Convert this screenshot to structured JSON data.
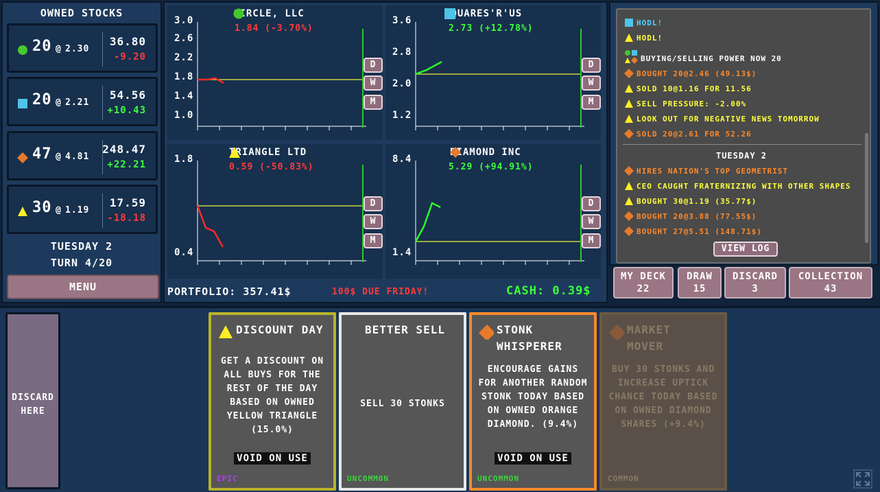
{
  "owned": {
    "title": "OWNED STOCKS",
    "stocks": [
      {
        "icon": "green-circle-icon",
        "qty": "20",
        "at": "@",
        "price": "2.30",
        "value": "36.80",
        "change": "-9.20",
        "change_color": "#ff3b3b"
      },
      {
        "icon": "blue-square-icon",
        "qty": "20",
        "at": "@",
        "price": "2.21",
        "value": "54.56",
        "change": "+10.43",
        "change_color": "#3cff3c"
      },
      {
        "icon": "orange-diamond-icon",
        "qty": "47",
        "at": "@",
        "price": "4.81",
        "value": "248.47",
        "change": "+22.21",
        "change_color": "#3cff3c"
      },
      {
        "icon": "yellow-triangle-icon",
        "qty": "30",
        "at": "@",
        "price": "1.19",
        "value": "17.59",
        "change": "-18.18",
        "change_color": "#ff3b3b"
      }
    ],
    "day": "TUESDAY 2",
    "turn": "TURN 4/20",
    "menu_label": "MENU"
  },
  "charts": [
    {
      "name": "CIRCLE, LLC",
      "icon": "green-circle-icon",
      "change_text": "1.84 (-3.70%)",
      "change_color": "#ff3b3b",
      "ticks": [
        "3.0",
        "2.6",
        "2.2",
        "1.8",
        "1.4",
        "1.0"
      ],
      "ylim": [
        1.0,
        3.0
      ]
    },
    {
      "name": "SQUARES'R'US",
      "icon": "blue-square-icon",
      "change_text": "2.73 (+12.78%)",
      "change_color": "#3cff3c",
      "ticks": [
        "3.6",
        "2.8",
        "2.0",
        "1.2"
      ],
      "ylim": [
        1.2,
        3.6
      ]
    },
    {
      "name": "TRIANGLE LTD",
      "icon": "yellow-triangle-icon",
      "change_text": "0.59 (-50.83%)",
      "change_color": "#ff3b3b",
      "ticks": [
        "1.8",
        "0.4"
      ],
      "ylim": [
        0.4,
        1.8
      ]
    },
    {
      "name": "DIAMOND INC",
      "icon": "orange-diamond-icon",
      "change_text": "5.29 (+94.91%)",
      "change_color": "#3cff3c",
      "ticks": [
        "8.4",
        "1.4"
      ],
      "ylim": [
        1.4,
        8.4
      ]
    }
  ],
  "dwm": {
    "d": "D",
    "w": "W",
    "m": "M"
  },
  "portfolio": {
    "label": "PORTFOLIO: 357.41$",
    "due": "100$ DUE FRIDAY!",
    "cash": "CASH: 0.39$"
  },
  "log": {
    "lines": [
      {
        "icons": [
          "blue-square-icon"
        ],
        "text": "HODL!",
        "color": "#4fd0ff"
      },
      {
        "icons": [
          "yellow-triangle-icon"
        ],
        "text": "HODL!",
        "color": "#ffff3c"
      },
      {
        "icons": [
          "green-circle-icon",
          "blue-square-icon",
          "yellow-triangle-icon",
          "orange-diamond-icon"
        ],
        "text": "BUYING/SELLING POWER NOW 20",
        "color": "#ffffff"
      },
      {
        "icons": [
          "orange-diamond-icon"
        ],
        "text": "BOUGHT 20@2.46 (49.13$)",
        "color": "#ff8a2a"
      },
      {
        "icons": [
          "yellow-triangle-icon"
        ],
        "text": "SOLD 10@1.16 FOR 11.56",
        "color": "#ffff3c"
      },
      {
        "icons": [
          "yellow-triangle-icon"
        ],
        "text": "SELL PRESSURE: -2.00%",
        "color": "#ffff3c"
      },
      {
        "icons": [
          "yellow-triangle-icon"
        ],
        "text": "LOOK OUT FOR NEGATIVE NEWS TOMORROW",
        "color": "#ffff3c"
      },
      {
        "icons": [
          "orange-diamond-icon"
        ],
        "text": "SOLD 20@2.61 FOR 52.26",
        "color": "#ff8a2a"
      }
    ],
    "day_header": "TUESDAY 2",
    "lines2": [
      {
        "icons": [
          "orange-diamond-icon"
        ],
        "text": "HIRES NATION'S TOP GEOMETRIST",
        "color": "#ff8a2a"
      },
      {
        "icons": [
          "yellow-triangle-icon"
        ],
        "text": "CEO CAUGHT FRATERNIZING WITH OTHER SHAPES",
        "color": "#ffff3c"
      },
      {
        "icons": [
          "yellow-triangle-icon"
        ],
        "text": "BOUGHT 30@1.19 (35.77$)",
        "color": "#ffff3c"
      },
      {
        "icons": [
          "orange-diamond-icon"
        ],
        "text": "BOUGHT 20@3.88 (77.55$)",
        "color": "#ff8a2a"
      },
      {
        "icons": [
          "orange-diamond-icon"
        ],
        "text": "BOUGHT 27@5.51 (148.71$)",
        "color": "#ff8a2a"
      }
    ],
    "view_log": "VIEW LOG"
  },
  "deck": {
    "my_deck": {
      "label": "MY DECK",
      "count": "22"
    },
    "draw": {
      "label": "DRAW",
      "count": "15"
    },
    "discard": {
      "label": "DISCARD",
      "count": "3"
    },
    "collection": {
      "label": "COLLECTION",
      "count": "43"
    }
  },
  "discard_zone": {
    "line1": "DISCARD",
    "line2": "HERE"
  },
  "cards": [
    {
      "title1": "DISCOUNT DAY",
      "title2": "",
      "icon": "yellow-triangle-icon",
      "desc": "GET A DISCOUNT ON ALL BUYS FOR THE REST OF THE DAY BASED ON OWNED YELLOW TRIANGLE (15.0%)",
      "void": "VOID ON USE",
      "rarity": "EPIC",
      "rarity_color": "#b43cff",
      "border": "#b9b32a"
    },
    {
      "title1": "BETTER SELL",
      "title2": "",
      "icon": "",
      "desc": "SELL 30 STONKS",
      "void": "",
      "rarity": "UNCOMMON",
      "rarity_color": "#3cd23c",
      "border": "#e8e8e8"
    },
    {
      "title1": "STONK",
      "title2": "WHISPERER",
      "icon": "orange-diamond-icon",
      "desc": "ENCOURAGE GAINS FOR ANOTHER RANDOM STONK TODAY BASED ON OWNED ORANGE DIAMOND. (9.4%)",
      "void": "VOID ON USE",
      "rarity": "UNCOMMON",
      "rarity_color": "#3cd23c",
      "border": "#ff8a2a"
    },
    {
      "title1": "MARKET",
      "title2": "MOVER",
      "icon": "orange-diamond-icon",
      "desc": "BUY 30 STONKS AND INCREASE UPTICK CHANCE TODAY BASED ON OWNED DIAMOND SHARES (+9.4%)",
      "void": "",
      "rarity": "COMMON",
      "rarity_color": "#8a7a66",
      "border": "#6a5a44"
    }
  ],
  "colors": {
    "green": "#3cff3c",
    "red": "#ff3b3b",
    "yellow_line": "#c8d23c",
    "axis": "#ffffff"
  }
}
